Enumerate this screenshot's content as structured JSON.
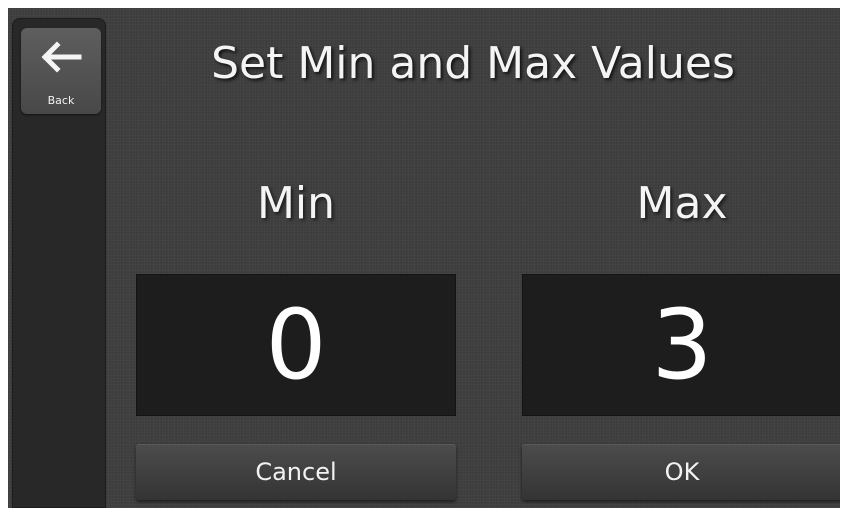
{
  "sidebar": {
    "back": {
      "label": "Back",
      "icon": "arrow-left-icon"
    }
  },
  "header": {
    "title": "Set Min and Max Values"
  },
  "min": {
    "label": "Min",
    "value": "0"
  },
  "max": {
    "label": "Max",
    "value": "3"
  },
  "actions": {
    "cancel_label": "Cancel",
    "ok_label": "OK"
  },
  "colors": {
    "background": "#3e3e3e",
    "sidebar": "#282828",
    "value_box": "#1d1d1d",
    "text": "#f4f4f4"
  }
}
